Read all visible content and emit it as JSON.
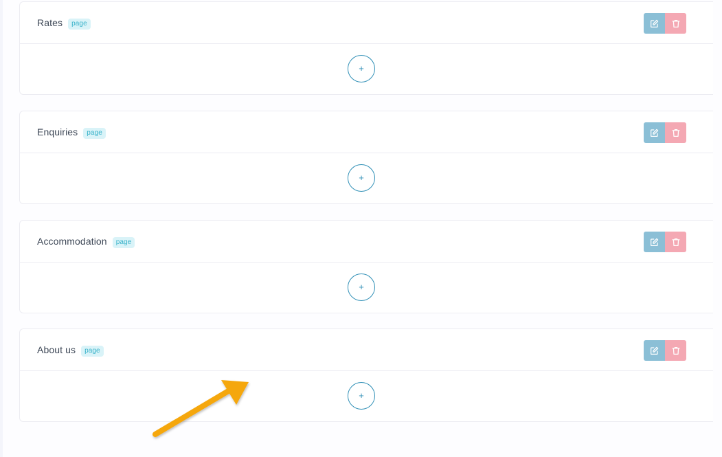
{
  "sections": [
    {
      "title": "Rates",
      "badge": "page",
      "add_symbol": "+"
    },
    {
      "title": "Enquiries",
      "badge": "page",
      "add_symbol": "+"
    },
    {
      "title": "Accommodation",
      "badge": "page",
      "add_symbol": "+"
    },
    {
      "title": "About us",
      "badge": "page",
      "add_symbol": "+"
    }
  ],
  "icons": {
    "edit": "edit-icon",
    "delete": "trash-icon",
    "annotation": "arrow-icon"
  },
  "colors": {
    "edit_button": "#8bbfd6",
    "delete_button": "#f4a8b3",
    "badge_text": "#38b2c9",
    "badge_bg": "#d9f3f8",
    "add_button": "#2f8fb6",
    "annotation_arrow": "#f5a70f"
  }
}
